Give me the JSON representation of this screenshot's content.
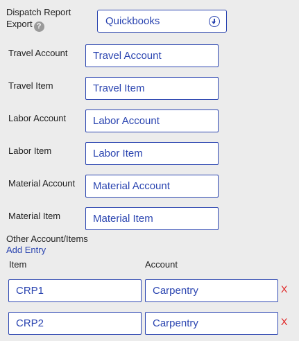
{
  "dispatch": {
    "label": "Dispatch Report Export",
    "help_icon": "question-mark-icon",
    "help_glyph": "?",
    "export_value": "Quickbooks",
    "dropdown_icon": "chevron-down-circle-icon"
  },
  "fields": [
    {
      "label": "Travel Account",
      "value": "Travel Account"
    },
    {
      "label": "Travel Item",
      "value": "Travel Item"
    },
    {
      "label": "Labor Account",
      "value": "Labor Account"
    },
    {
      "label": "Labor Item",
      "value": "Labor Item"
    },
    {
      "label": "Material Account",
      "value": "Material Account"
    },
    {
      "label": "Material Item",
      "value": "Material Item"
    }
  ],
  "other": {
    "heading": "Other Account/Items",
    "add_entry": "Add Entry",
    "col_item": "Item",
    "col_account": "Account",
    "remove_glyph": "X",
    "entries": [
      {
        "item": "CRP1",
        "account": "Carpentry"
      },
      {
        "item": "CRP2",
        "account": "Carpentry"
      }
    ]
  },
  "colors": {
    "accent": "#2a44b0",
    "remove": "#e02020",
    "background": "#ececec"
  }
}
